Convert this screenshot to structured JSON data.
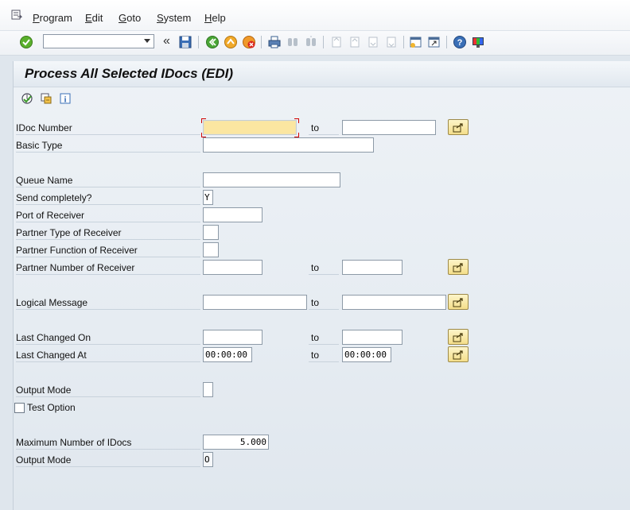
{
  "menu": {
    "items": [
      {
        "label": "Program",
        "mnemonic": "P",
        "rest": "rogram"
      },
      {
        "label": "Edit",
        "mnemonic": "E",
        "rest": "dit"
      },
      {
        "label": "Goto",
        "mnemonic": "G",
        "rest": "oto"
      },
      {
        "label": "System",
        "mnemonic": "S",
        "rest": "ystem"
      },
      {
        "label": "Help",
        "mnemonic": "H",
        "rest": "elp"
      }
    ]
  },
  "toolbar": {
    "command_field_value": "",
    "history_glyph": "«"
  },
  "page": {
    "title": "Process All Selected IDocs (EDI)"
  },
  "form": {
    "to_label": "to",
    "idoc_number": {
      "label": "IDoc Number",
      "from": "",
      "to": ""
    },
    "basic_type": {
      "label": "Basic Type",
      "value": ""
    },
    "queue_name": {
      "label": "Queue Name",
      "value": ""
    },
    "send_completely": {
      "label": "Send completely?",
      "value": "Y"
    },
    "port_of_receiver": {
      "label": "Port of Receiver",
      "value": ""
    },
    "partner_type": {
      "label": "Partner Type of Receiver",
      "value": ""
    },
    "partner_function": {
      "label": "Partner Function of Receiver",
      "value": ""
    },
    "partner_number": {
      "label": "Partner Number of Receiver",
      "from": "",
      "to": ""
    },
    "logical_message": {
      "label": "Logical Message",
      "from": "",
      "to": ""
    },
    "last_changed_on": {
      "label": "Last Changed On",
      "from": "",
      "to": ""
    },
    "last_changed_at": {
      "label": "Last Changed At",
      "from": "00:00:00",
      "to": "00:00:00"
    },
    "output_mode_1": {
      "label": "Output Mode",
      "value": ""
    },
    "test_option": {
      "label": "Test Option",
      "checked": false
    },
    "max_idocs": {
      "label": "Maximum Number of IDocs",
      "value": "5.000"
    },
    "output_mode_2": {
      "label": "Output Mode",
      "value": "O"
    }
  },
  "colors": {
    "focus_field": "#fbe6a1",
    "multi_select_button": "#f4de8a",
    "background": "#dfe6ed"
  }
}
